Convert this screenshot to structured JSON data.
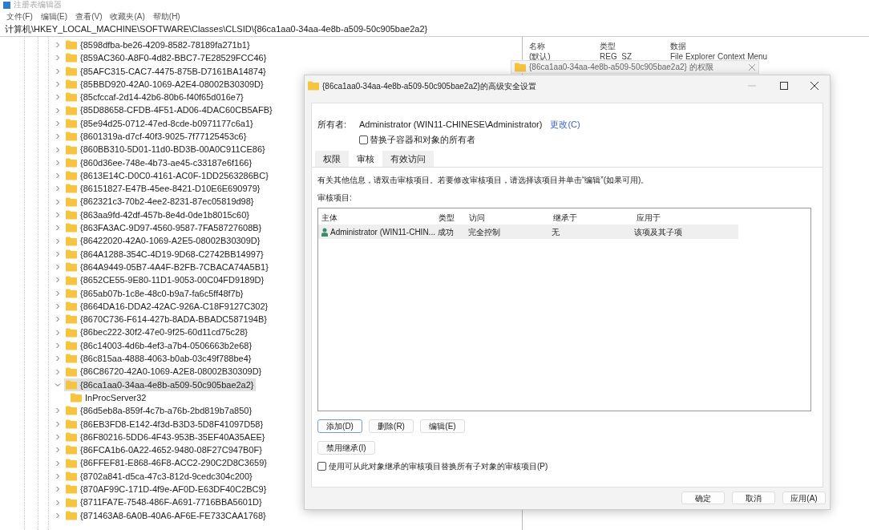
{
  "registry_editor": {
    "title": "注册表编辑器",
    "menu": [
      "文件(F)",
      "编辑(E)",
      "查看(V)",
      "收藏夹(A)",
      "帮助(H)"
    ],
    "address": "计算机\\HKEY_LOCAL_MACHINE\\SOFTWARE\\Classes\\CLSID\\{86ca1aa0-34aa-4e8b-a509-50c905bae2a2}",
    "tree": [
      {
        "label": "{8598dfba-be26-4209-8582-78189fa271b1}",
        "expanded": false,
        "selected": false
      },
      {
        "label": "{859AC360-A8F0-4d82-BBC7-7E28529FCC46}",
        "expanded": false,
        "selected": false
      },
      {
        "label": "{85AFC315-CAC7-4475-875B-D7161BA14874}",
        "expanded": false,
        "selected": false
      },
      {
        "label": "{85BBD920-42A0-1069-A2E4-08002B30309D}",
        "expanded": false,
        "selected": false
      },
      {
        "label": "{85cfccaf-2d14-42b6-80b6-f40f65d016e7}",
        "expanded": false,
        "selected": false
      },
      {
        "label": "{85D88658-CFDB-4F51-AD06-4DAC60CB5AFB}",
        "expanded": false,
        "selected": false
      },
      {
        "label": "{85e94d25-0712-47ed-8cde-b0971177c6a1}",
        "expanded": false,
        "selected": false
      },
      {
        "label": "{8601319a-d7cf-40f3-9025-7f77125453c6}",
        "expanded": false,
        "selected": false
      },
      {
        "label": "{860BB310-5D01-11d0-BD3B-00A0C911CE86}",
        "expanded": false,
        "selected": false
      },
      {
        "label": "{860d36ee-748e-4b73-ae45-c33187e6f166}",
        "expanded": false,
        "selected": false
      },
      {
        "label": "{8613E14C-D0C0-4161-AC0F-1DD2563286BC}",
        "expanded": false,
        "selected": false
      },
      {
        "label": "{86151827-E47B-45ee-8421-D10E6E690979}",
        "expanded": false,
        "selected": false
      },
      {
        "label": "{862321c3-70b2-4ee2-8231-87ec05819d98}",
        "expanded": false,
        "selected": false
      },
      {
        "label": "{863aa9fd-42df-457b-8e4d-0de1b8015c60}",
        "expanded": false,
        "selected": false
      },
      {
        "label": "{863FA3AC-9D97-4560-9587-7FA58727608B}",
        "expanded": false,
        "selected": false
      },
      {
        "label": "{86422020-42A0-1069-A2E5-08002B30309D}",
        "expanded": false,
        "selected": false
      },
      {
        "label": "{864A1288-354C-4D19-9D68-C2742BB14997}",
        "expanded": false,
        "selected": false
      },
      {
        "label": "{864A9449-05B7-4A4F-B2FB-7CBACA74A5B1}",
        "expanded": false,
        "selected": false
      },
      {
        "label": "{8652CE55-9E80-11D1-9053-00C04FD9189D}",
        "expanded": false,
        "selected": false
      },
      {
        "label": "{865ab07b-1c8e-48c0-b9a7-fa6c5ff48f7b}",
        "expanded": false,
        "selected": false
      },
      {
        "label": "{8664DA16-DDA2-42AC-926A-C18F9127C302}",
        "expanded": false,
        "selected": false
      },
      {
        "label": "{8670C736-F614-427b-8ADA-BBADC587194B}",
        "expanded": false,
        "selected": false
      },
      {
        "label": "{86bec222-30f2-47e0-9f25-60d11cd75c28}",
        "expanded": false,
        "selected": false
      },
      {
        "label": "{86c14003-4d6b-4ef3-a7b4-0506663b2e68}",
        "expanded": false,
        "selected": false
      },
      {
        "label": "{86c815aa-4888-4063-b0ab-03c49f788be4}",
        "expanded": false,
        "selected": false
      },
      {
        "label": "{86C86720-42A0-1069-A2E8-08002B30309D}",
        "expanded": false,
        "selected": false
      },
      {
        "label": "{86ca1aa0-34aa-4e8b-a509-50c905bae2a2}",
        "expanded": true,
        "selected": true,
        "children": [
          {
            "label": "InProcServer32",
            "selected": false
          }
        ]
      },
      {
        "label": "{86d5eb8a-859f-4c7b-a76b-2bd819b7a850}",
        "expanded": false,
        "selected": false
      },
      {
        "label": "{86EB3FD8-E142-4f3d-B3D3-5D8F41097D58}",
        "expanded": false,
        "selected": false
      },
      {
        "label": "{86F80216-5DD6-4F43-953B-35EF40A35AEE}",
        "expanded": false,
        "selected": false
      },
      {
        "label": "{86FCA1b6-0A22-4652-9480-08F27C947B0F}",
        "expanded": false,
        "selected": false
      },
      {
        "label": "{86FFEF81-E868-46F8-ACC2-290C2D8C3659}",
        "expanded": false,
        "selected": false
      },
      {
        "label": "{8702a841-d5ca-47c3-812d-9cedc304c200}",
        "expanded": false,
        "selected": false
      },
      {
        "label": "{870AF99C-171D-4f9e-AF0D-E63DF40C2BC9}",
        "expanded": false,
        "selected": false
      },
      {
        "label": "{8711FA7E-7548-486F-A691-7716BBA5601D}",
        "expanded": false,
        "selected": false
      },
      {
        "label": "{871463A8-6A0B-40A6-AF6E-FE733CAA1768}",
        "expanded": false,
        "selected": false
      }
    ],
    "values_pane": {
      "columns": [
        "名称",
        "类型",
        "数据"
      ],
      "rows": [
        {
          "name": "(默认)",
          "type": "REG_SZ",
          "data": "File Explorer Context Menu"
        }
      ]
    }
  },
  "permissions_window": {
    "title": "{86ca1aa0-34aa-4e8b-a509-50c905bae2a2} 的权限"
  },
  "dialog": {
    "title": "{86ca1aa0-34aa-4e8b-a509-50c905bae2a2}的高级安全设置",
    "owner_label": "所有者:",
    "owner": "Administrator (WIN11-CHINESE\\Administrator)",
    "change_link": "更改(C)",
    "replace_owner": {
      "label": "替换子容器和对象的所有者",
      "checked": false
    },
    "tabs": [
      {
        "label": "权限",
        "selected": false
      },
      {
        "label": "审核",
        "selected": true
      },
      {
        "label": "有效访问",
        "selected": false
      }
    ],
    "info": "有关其他信息，请双击审核项目。若要修改审核项目，请选择该项目并单击“编辑”(如果可用)。",
    "entries_label": "审核项目:",
    "table": {
      "columns": [
        "主体",
        "类型",
        "访问",
        "继承于",
        "应用于"
      ],
      "rows": [
        {
          "cells": [
            "Administrator (WIN11-CHIN...",
            "成功",
            "完全控制",
            "无",
            "该项及其子项"
          ],
          "selected": true
        }
      ]
    },
    "row_buttons": [
      {
        "label": "添加(D)",
        "default": true
      },
      {
        "label": "删除(R)",
        "default": false
      },
      {
        "label": "编辑(E)",
        "default": false
      }
    ],
    "inherit_button": "禁用继承(I)",
    "replace_children": {
      "label": "使用可从此对象继承的审核项目替换所有子对象的审核项目(P)",
      "checked": false
    },
    "footer_buttons": [
      "确定",
      "取消",
      "应用(A)"
    ]
  }
}
